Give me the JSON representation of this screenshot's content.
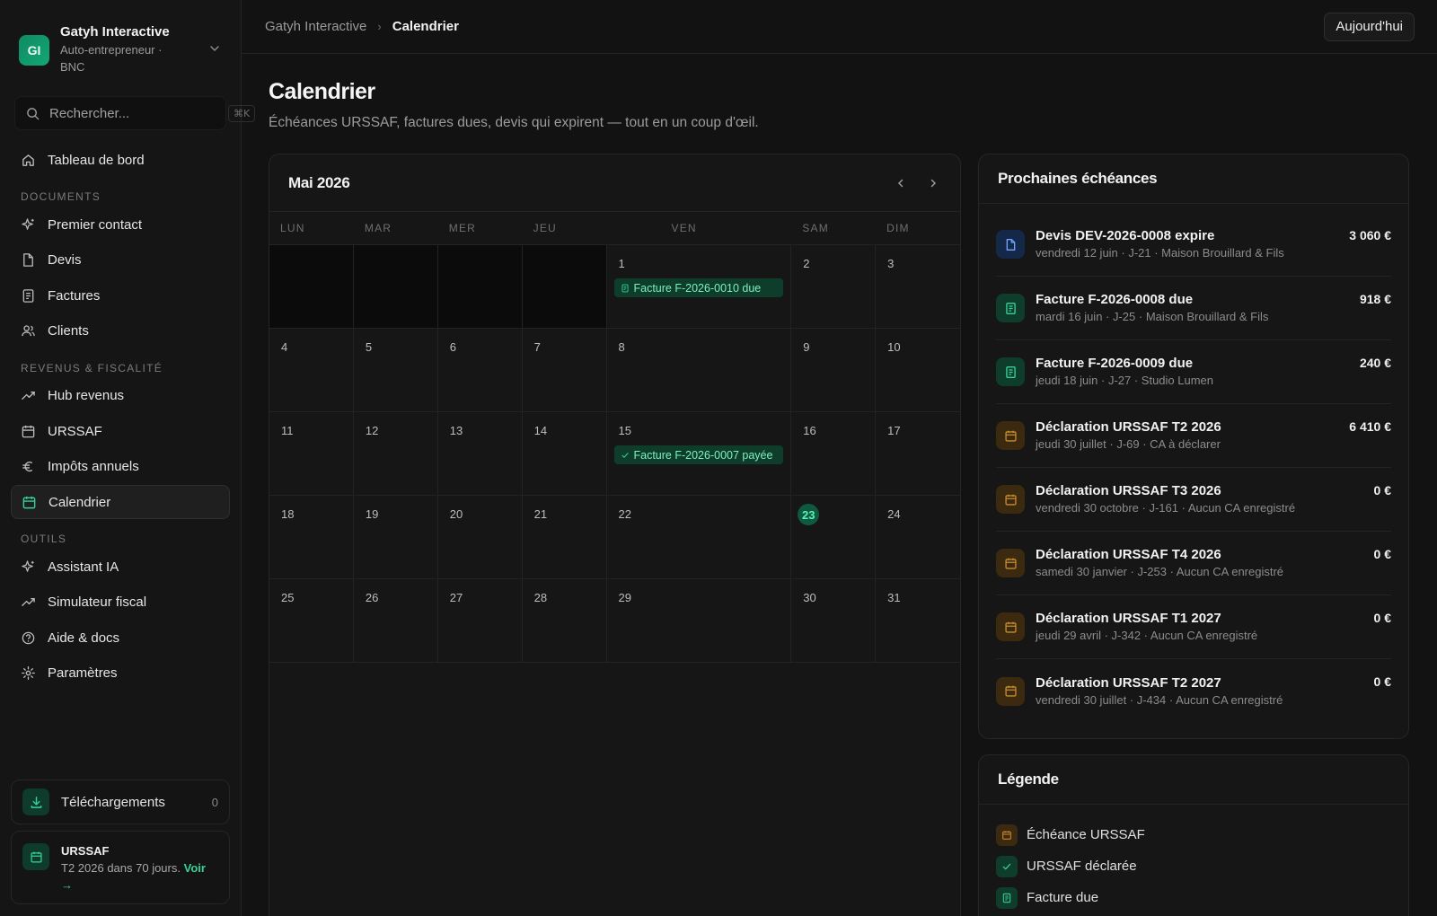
{
  "brand": {
    "initials": "GI",
    "name": "Gatyh Interactive",
    "subtitle": "Auto-entrepreneur · BNC"
  },
  "search": {
    "placeholder": "Rechercher...",
    "shortcut": "⌘K"
  },
  "nav": {
    "dashboard": "Tableau de bord",
    "section_documents": "DOCUMENTS",
    "first_contact": "Premier contact",
    "quotes": "Devis",
    "invoices": "Factures",
    "clients": "Clients",
    "section_revenue": "REVENUS & FISCALITÉ",
    "revenue_hub": "Hub revenus",
    "urssaf": "URSSAF",
    "annual_taxes": "Impôts annuels",
    "calendar": "Calendrier",
    "section_tools": "OUTILS",
    "ai_assistant": "Assistant IA",
    "tax_simulator": "Simulateur fiscal",
    "help": "Aide & docs",
    "settings": "Paramètres"
  },
  "downloads": {
    "label": "Téléchargements",
    "count": "0"
  },
  "urssaf_card": {
    "title": "URSSAF",
    "text": "T2 2026 dans 70 jours.",
    "link": "Voir →"
  },
  "breadcrumb": {
    "parent": "Gatyh Interactive",
    "separator": "›",
    "current": "Calendrier"
  },
  "today_button": "Aujourd'hui",
  "page": {
    "title": "Calendrier",
    "subtitle": "Échéances URSSAF, factures dues, devis qui expirent — tout en un coup d'œil."
  },
  "calendar": {
    "month": "Mai 2026",
    "weekdays": [
      "LUN",
      "MAR",
      "MER",
      "JEU",
      "VEN",
      "SAM",
      "DIM"
    ],
    "weeks": [
      [
        {
          "n": ""
        },
        {
          "n": ""
        },
        {
          "n": ""
        },
        {
          "n": ""
        },
        {
          "n": "1",
          "event": "Facture F-2026-0010 due",
          "event_icon": "invoice-icon"
        },
        {
          "n": "2"
        },
        {
          "n": "3"
        }
      ],
      [
        {
          "n": "4"
        },
        {
          "n": "5"
        },
        {
          "n": "6"
        },
        {
          "n": "7"
        },
        {
          "n": "8"
        },
        {
          "n": "9"
        },
        {
          "n": "10"
        }
      ],
      [
        {
          "n": "11"
        },
        {
          "n": "12"
        },
        {
          "n": "13"
        },
        {
          "n": "14"
        },
        {
          "n": "15",
          "event": "Facture F-2026-0007 payée",
          "event_icon": "check-icon"
        },
        {
          "n": "16"
        },
        {
          "n": "17"
        }
      ],
      [
        {
          "n": "18"
        },
        {
          "n": "19"
        },
        {
          "n": "20"
        },
        {
          "n": "21"
        },
        {
          "n": "22"
        },
        {
          "n": "23",
          "today": true
        },
        {
          "n": "24"
        }
      ],
      [
        {
          "n": "25"
        },
        {
          "n": "26"
        },
        {
          "n": "27"
        },
        {
          "n": "28"
        },
        {
          "n": "29"
        },
        {
          "n": "30"
        },
        {
          "n": "31"
        }
      ]
    ]
  },
  "upcoming": {
    "title": "Prochaines échéances",
    "items": [
      {
        "icon": "document-icon",
        "tone": "blue",
        "title": "Devis DEV-2026-0008 expire",
        "meta": "vendredi 12 juin · J-21 · Maison Brouillard & Fils",
        "amount": "3 060 €"
      },
      {
        "icon": "invoice-icon",
        "tone": "green",
        "title": "Facture F-2026-0008 due",
        "meta": "mardi 16 juin · J-25 · Maison Brouillard & Fils",
        "amount": "918 €"
      },
      {
        "icon": "invoice-icon",
        "tone": "green",
        "title": "Facture F-2026-0009 due",
        "meta": "jeudi 18 juin · J-27 · Studio Lumen",
        "amount": "240 €"
      },
      {
        "icon": "calendar-icon",
        "tone": "amber",
        "title": "Déclaration URSSAF T2 2026",
        "meta": "jeudi 30 juillet · J-69 · CA à déclarer",
        "amount": "6 410 €"
      },
      {
        "icon": "calendar-icon",
        "tone": "amber",
        "title": "Déclaration URSSAF T3 2026",
        "meta": "vendredi 30 octobre · J-161 · Aucun CA enregistré",
        "amount": "0 €"
      },
      {
        "icon": "calendar-icon",
        "tone": "amber",
        "title": "Déclaration URSSAF T4 2026",
        "meta": "samedi 30 janvier · J-253 · Aucun CA enregistré",
        "amount": "0 €"
      },
      {
        "icon": "calendar-icon",
        "tone": "amber",
        "title": "Déclaration URSSAF T1 2027",
        "meta": "jeudi 29 avril · J-342 · Aucun CA enregistré",
        "amount": "0 €"
      },
      {
        "icon": "calendar-icon",
        "tone": "amber",
        "title": "Déclaration URSSAF T2 2027",
        "meta": "vendredi 30 juillet · J-434 · Aucun CA enregistré",
        "amount": "0 €"
      }
    ]
  },
  "legend": {
    "title": "Légende",
    "items": [
      {
        "icon": "calendar-icon",
        "tone": "amber",
        "label": "Échéance URSSAF"
      },
      {
        "icon": "check-icon",
        "tone": "green",
        "label": "URSSAF déclarée"
      },
      {
        "icon": "invoice-icon",
        "tone": "green",
        "label": "Facture due"
      }
    ]
  },
  "colors": {
    "accent": "#35d39a",
    "accent_bg": "#0f3d2c",
    "amber": "#c88a2c",
    "amber_bg": "#3b2a10",
    "blue": "#6fa3ff",
    "blue_bg": "#14294a"
  }
}
